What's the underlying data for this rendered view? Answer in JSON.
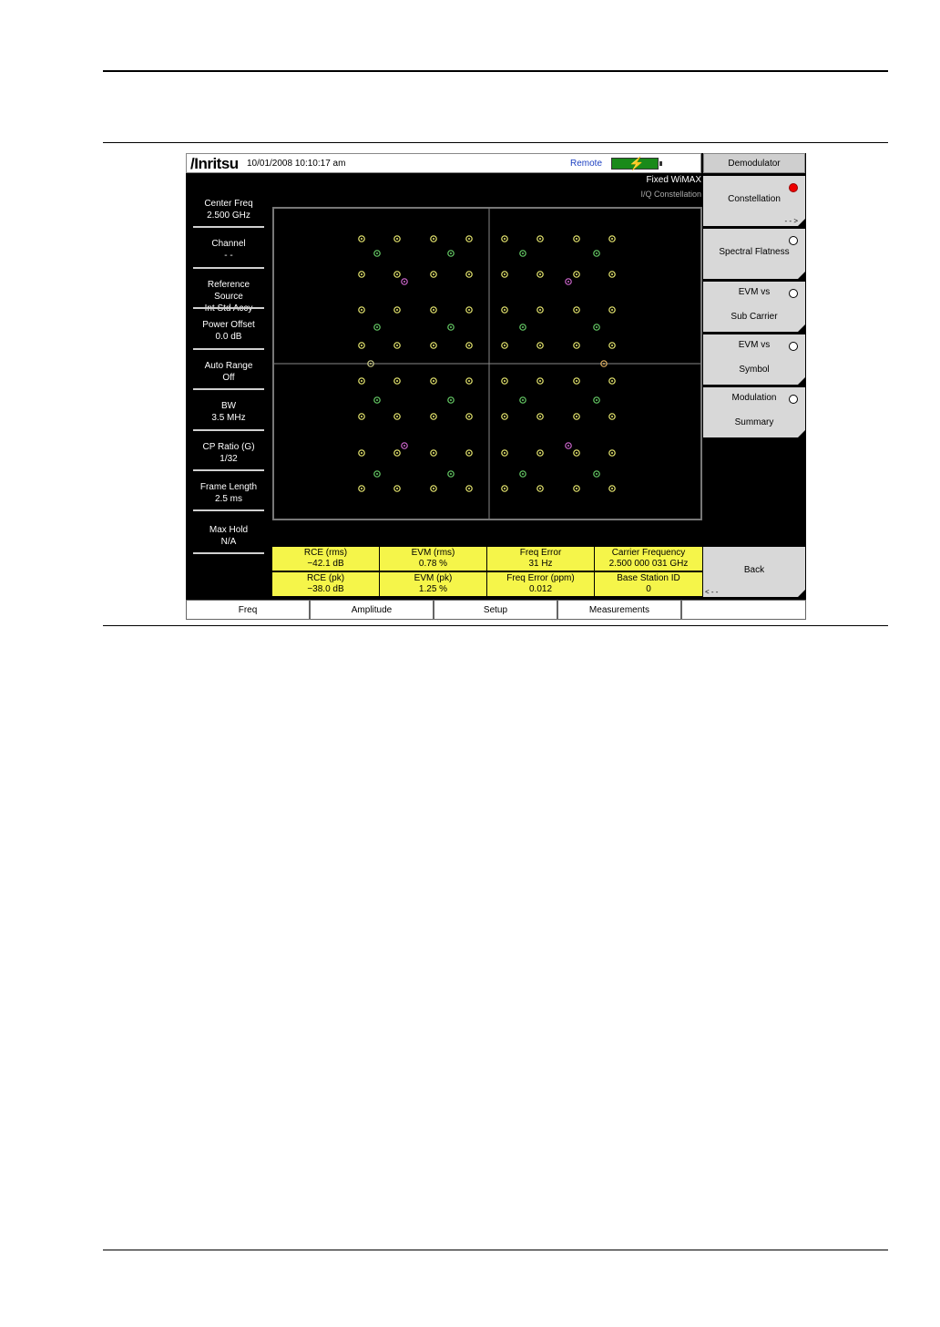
{
  "header": {
    "logo": "/Inritsu",
    "datetime": "10/01/2008 10:10:17 am",
    "remote": "Remote"
  },
  "mode": {
    "standard": "Fixed WiMAX",
    "view": "I/Q Constellation"
  },
  "left_panel": [
    {
      "label": "Center Freq",
      "value": "2.500 GHz"
    },
    {
      "label": "Channel",
      "value": "- -"
    },
    {
      "label": "Reference Source",
      "value": "Int Std Accy"
    },
    {
      "label": "Power Offset",
      "value": "0.0 dB"
    },
    {
      "label": "Auto Range",
      "value": "Off"
    },
    {
      "label": "BW",
      "value": "3.5 MHz"
    },
    {
      "label": "CP Ratio (G)",
      "value": "1/32"
    },
    {
      "label": "Frame Length",
      "value": "2.5 ms"
    },
    {
      "label": "Max Hold",
      "value": "N/A"
    }
  ],
  "right_menu": {
    "title": "Demodulator",
    "items": [
      {
        "line1": "Constellation",
        "line2": "",
        "more": "- - >",
        "selected": true
      },
      {
        "line1": "Spectral Flatness",
        "line2": "",
        "more": "",
        "selected": false
      },
      {
        "line1": "EVM vs",
        "line2": "Sub Carrier",
        "more": "",
        "selected": false
      },
      {
        "line1": "EVM vs",
        "line2": "Symbol",
        "more": "",
        "selected": false
      },
      {
        "line1": "Modulation",
        "line2": "Summary",
        "more": "",
        "selected": false
      }
    ],
    "back_label": "Back",
    "back_more": "< - -"
  },
  "measurements": [
    {
      "label": "RCE (rms)",
      "value": "−42.1 dB"
    },
    {
      "label": "EVM (rms)",
      "value": "0.78 %"
    },
    {
      "label": "Freq Error",
      "value": "31 Hz"
    },
    {
      "label": "Carrier Frequency",
      "value": "2.500 000 031 GHz"
    },
    {
      "label": "RCE (pk)",
      "value": "−38.0 dB"
    },
    {
      "label": "EVM (pk)",
      "value": "1.25 %"
    },
    {
      "label": "Freq Error (ppm)",
      "value": "0.012"
    },
    {
      "label": "Base Station ID",
      "value": "0"
    }
  ],
  "bottom_tabs": [
    "Freq",
    "Amplitude",
    "Setup",
    "Measurements",
    ""
  ],
  "colors": {
    "highlight": "#f5f54a",
    "active_indicator": "#e00000",
    "battery": "#1a8a1a",
    "pilot_points": "#66cc66",
    "data_points": "#e8e870",
    "preamble_points": "#cc66cc"
  }
}
